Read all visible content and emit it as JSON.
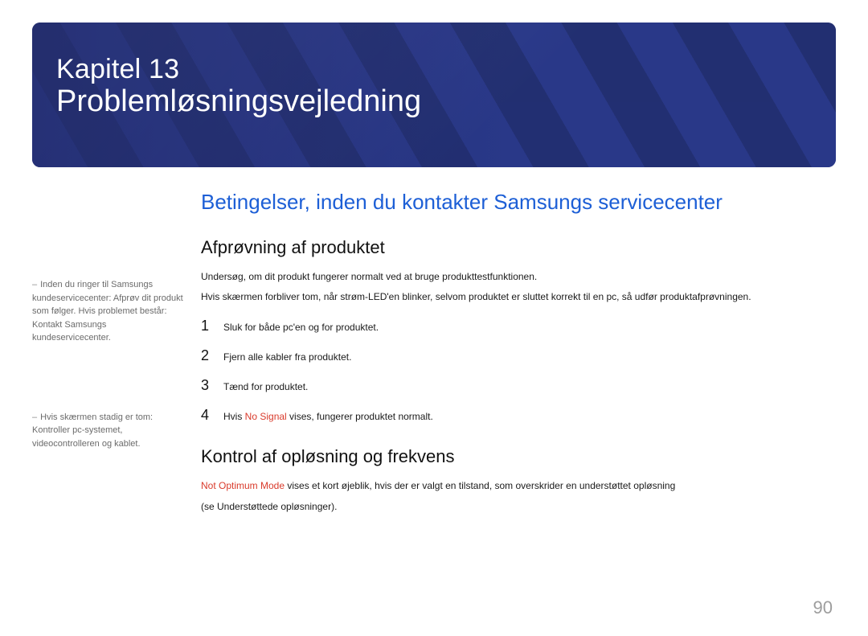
{
  "banner": {
    "chapter_label": "Kapitel 13",
    "title": "Problemløsningsvejledning"
  },
  "sidebar": {
    "note1_prefix": "–",
    "note1": "Inden du ringer til Samsungs kundeservicecenter: Afprøv dit produkt som følger. Hvis problemet består: Kontakt Samsungs kundeservicecenter.",
    "note2_prefix": "–",
    "note2": "Hvis skærmen stadig er tom: Kontroller pc-systemet, videocontrolleren og kablet."
  },
  "main": {
    "section_heading": "Betingelser, inden du kontakter Samsungs servicecenter",
    "sub1_heading": "Afprøvning af produktet",
    "sub1_p1": "Undersøg, om dit produkt fungerer normalt ved at bruge produkttestfunktionen.",
    "sub1_p2": "Hvis skærmen forbliver tom, når strøm-LED'en blinker, selvom produktet er sluttet korrekt til en pc, så udfør produktafprøvningen.",
    "steps": [
      {
        "n": "1",
        "text": "Sluk for både pc'en og for produktet."
      },
      {
        "n": "2",
        "text": "Fjern alle kabler fra produktet."
      },
      {
        "n": "3",
        "text": "Tænd for produktet."
      },
      {
        "n": "4",
        "pre": "Hvis ",
        "red": "No Signal",
        "post": " vises, fungerer produktet normalt."
      }
    ],
    "sub2_heading": "Kontrol af opløsning og frekvens",
    "sub2_red": "Not Optimum Mode",
    "sub2_after": " vises et kort øjeblik, hvis der er valgt en tilstand, som overskrider en understøttet opløsning",
    "sub2_line2": "(se Understøttede opløsninger)."
  },
  "page_number": "90"
}
